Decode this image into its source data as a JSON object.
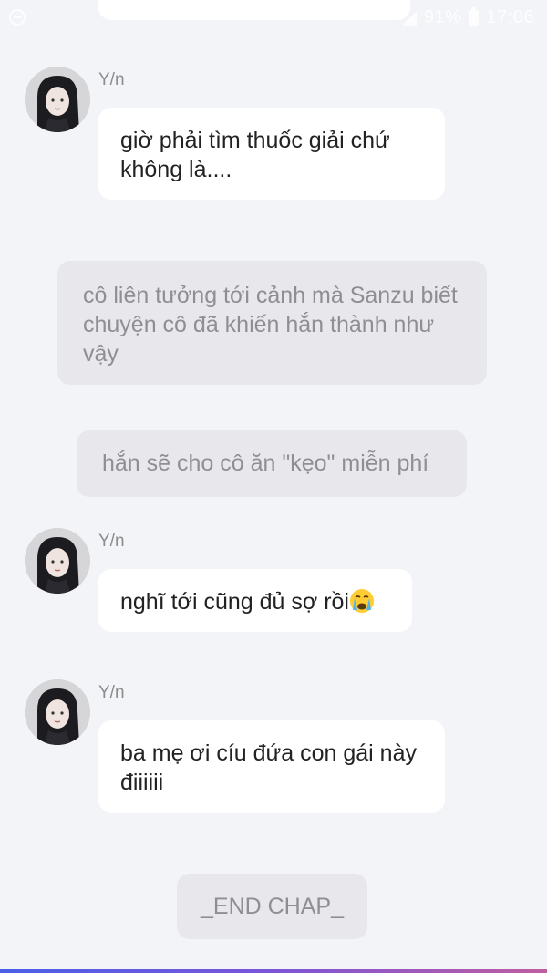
{
  "status_bar": {
    "battery": "91%",
    "time": "17:06"
  },
  "messages": [
    {
      "type": "character",
      "sender": "Y/n",
      "text": "giờ phải tìm thuốc giải chứ không là...."
    },
    {
      "type": "narration",
      "text": "cô liên tưởng tới cảnh mà Sanzu biết chuyện cô đã khiến hắn thành như vậy"
    },
    {
      "type": "narration",
      "text": "hắn sẽ cho cô ăn \"kẹo\" miễn phí"
    },
    {
      "type": "character",
      "sender": "Y/n",
      "text": "nghĩ tới cũng đủ sợ rồi",
      "emoji": "loudly-crying-face"
    },
    {
      "type": "character",
      "sender": "Y/n",
      "text": "ba mẹ ơi cíu đứa con gái này điiiiii"
    },
    {
      "type": "narration",
      "text": "_END CHAP_"
    }
  ],
  "colors": {
    "background": "#f3f4f8",
    "character_bubble": "#ffffff",
    "narration_bubble": "#e8e8ec",
    "narration_text": "#8f8f92",
    "sender_name": "#8c8c8c"
  }
}
